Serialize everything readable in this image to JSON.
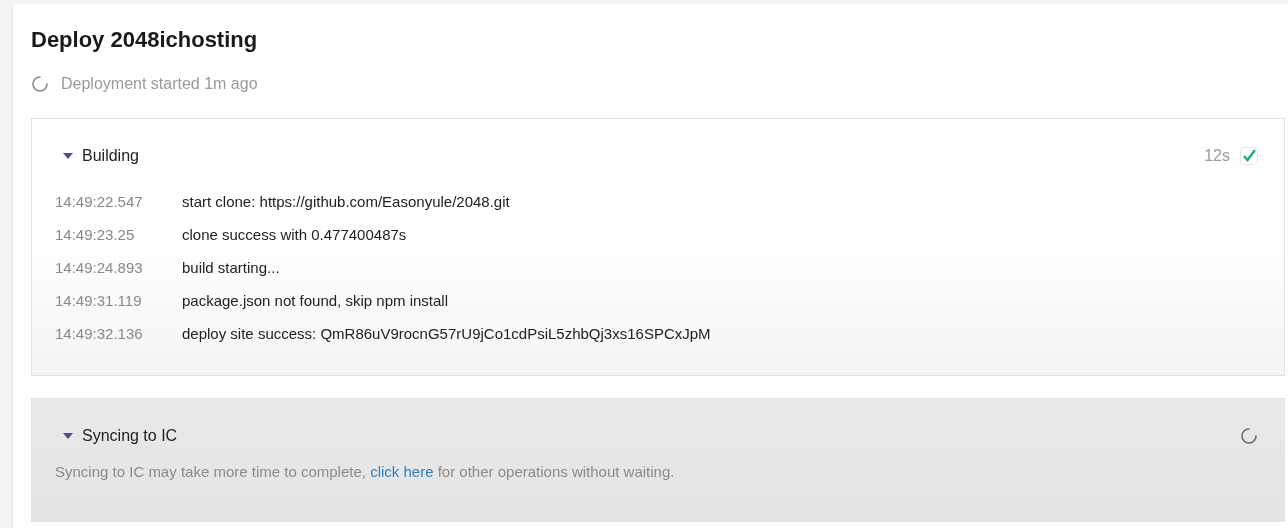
{
  "title": "Deploy 2048ichosting",
  "status": {
    "text": "Deployment started 1m ago",
    "loading": true
  },
  "stages": [
    {
      "kind": "log",
      "title": "Building",
      "expanded": true,
      "complete": true,
      "duration": "12s",
      "logs": [
        {
          "time": "14:49:22.547",
          "message": "start clone: https://github.com/Easonyule/2048.git"
        },
        {
          "time": "14:49:23.25",
          "message": "clone success with 0.477400487s"
        },
        {
          "time": "14:49:24.893",
          "message": "build starting..."
        },
        {
          "time": "14:49:31.119",
          "message": "package.json not found, skip npm install"
        },
        {
          "time": "14:49:32.136",
          "message": "deploy site success: QmR86uV9rocnG57rU9jCo1cdPsiL5zhbQj3xs16SPCxJpM"
        }
      ]
    },
    {
      "kind": "message",
      "title": "Syncing to IC",
      "expanded": true,
      "complete": false,
      "note": {
        "before": "Syncing to IC may take more time to complete,",
        "link": "click here",
        "after": "for other operations without waiting."
      }
    }
  ]
}
